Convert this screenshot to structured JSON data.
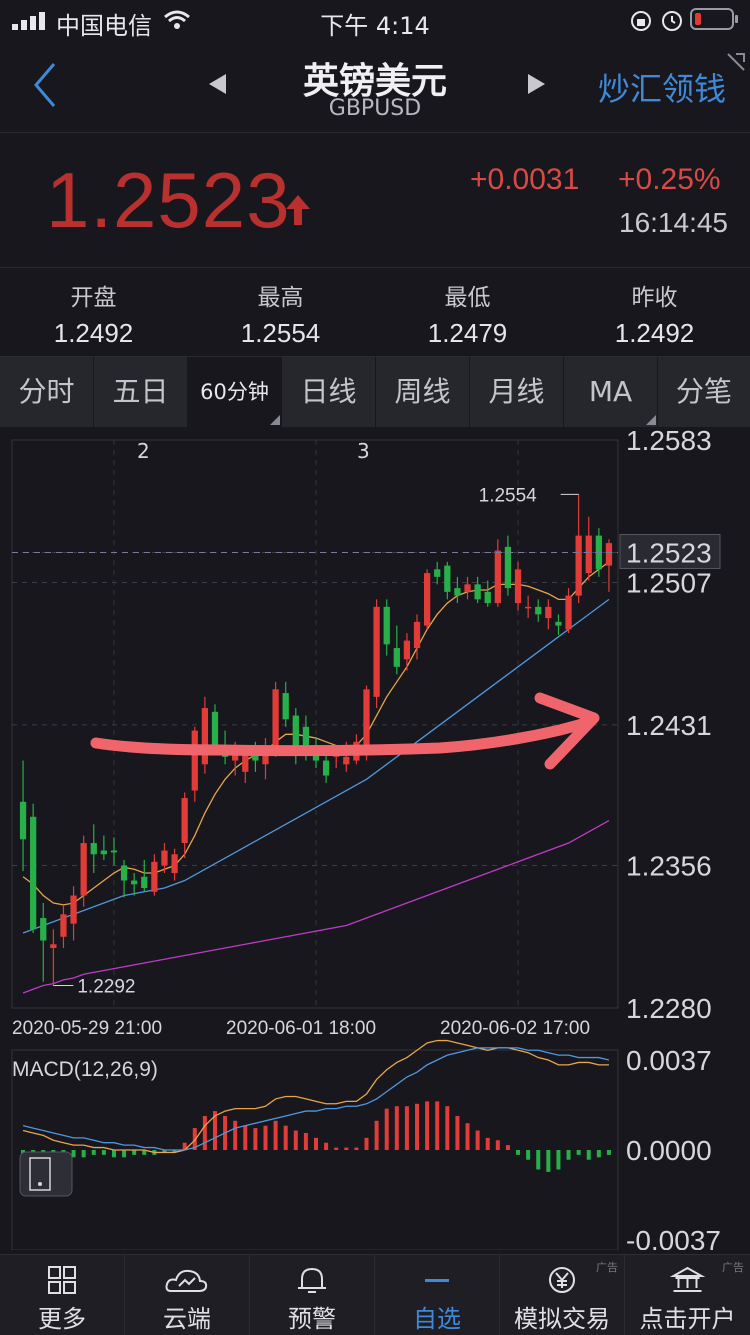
{
  "status": {
    "carrier": "中国电信",
    "time": "下午 4:14"
  },
  "nav": {
    "title": "英镑美元",
    "subtitle": "GBPUSD",
    "right_action": "炒汇领钱"
  },
  "quote": {
    "price": "1.2523",
    "change": "+0.0031",
    "change_pct": "+0.25%",
    "time": "16:14:45",
    "up_color": "#d94a45"
  },
  "stats": [
    {
      "label": "开盘",
      "value": "1.2492"
    },
    {
      "label": "最高",
      "value": "1.2554"
    },
    {
      "label": "最低",
      "value": "1.2479"
    },
    {
      "label": "昨收",
      "value": "1.2492"
    }
  ],
  "tabs": [
    "分时",
    "五日",
    "60分钟",
    "日线",
    "周线",
    "月线",
    "MA",
    "分笔"
  ],
  "active_tab": 2,
  "chart_data": [
    {
      "type": "candlestick",
      "y_ticks": [
        "1.2583",
        "1.2523",
        "1.2507",
        "1.2431",
        "1.2356",
        "1.2280"
      ],
      "ylim": [
        1.228,
        1.2583
      ],
      "x_ticks": [
        "2020-05-29 21:00",
        "2020-06-01 18:00",
        "2020-06-02 17:00"
      ],
      "annotations": {
        "high": "1.2554",
        "low": "1.2292"
      },
      "top_markers": [
        "2",
        "3"
      ],
      "current_price_label": "1.2523",
      "candles": [
        {
          "o": 1.239,
          "h": 1.2412,
          "l": 1.2353,
          "c": 1.237
        },
        {
          "o": 1.2382,
          "h": 1.2389,
          "l": 1.232,
          "c": 1.2322
        },
        {
          "o": 1.2328,
          "h": 1.2336,
          "l": 1.2294,
          "c": 1.2316
        },
        {
          "o": 1.2312,
          "h": 1.2322,
          "l": 1.2292,
          "c": 1.2314
        },
        {
          "o": 1.2318,
          "h": 1.2335,
          "l": 1.2312,
          "c": 1.233
        },
        {
          "o": 1.2325,
          "h": 1.2345,
          "l": 1.2316,
          "c": 1.234
        },
        {
          "o": 1.234,
          "h": 1.2372,
          "l": 1.2334,
          "c": 1.2368
        },
        {
          "o": 1.2368,
          "h": 1.2378,
          "l": 1.2352,
          "c": 1.2362
        },
        {
          "o": 1.2364,
          "h": 1.2372,
          "l": 1.2359,
          "c": 1.2362
        },
        {
          "o": 1.2364,
          "h": 1.2371,
          "l": 1.2356,
          "c": 1.2363
        },
        {
          "o": 1.2356,
          "h": 1.2359,
          "l": 1.2339,
          "c": 1.2348
        },
        {
          "o": 1.2348,
          "h": 1.2352,
          "l": 1.234,
          "c": 1.2346
        },
        {
          "o": 1.235,
          "h": 1.2359,
          "l": 1.2342,
          "c": 1.2344
        },
        {
          "o": 1.2342,
          "h": 1.2362,
          "l": 1.234,
          "c": 1.2358
        },
        {
          "o": 1.2356,
          "h": 1.2368,
          "l": 1.2352,
          "c": 1.2364
        },
        {
          "o": 1.2352,
          "h": 1.2365,
          "l": 1.2348,
          "c": 1.2362
        },
        {
          "o": 1.2368,
          "h": 1.2395,
          "l": 1.236,
          "c": 1.2392
        },
        {
          "o": 1.2396,
          "h": 1.243,
          "l": 1.239,
          "c": 1.2428
        },
        {
          "o": 1.241,
          "h": 1.2446,
          "l": 1.2405,
          "c": 1.244
        },
        {
          "o": 1.2438,
          "h": 1.2442,
          "l": 1.2416,
          "c": 1.242
        },
        {
          "o": 1.242,
          "h": 1.2428,
          "l": 1.241,
          "c": 1.2414
        },
        {
          "o": 1.2412,
          "h": 1.2422,
          "l": 1.2404,
          "c": 1.2418
        },
        {
          "o": 1.2406,
          "h": 1.242,
          "l": 1.24,
          "c": 1.2416
        },
        {
          "o": 1.2418,
          "h": 1.2422,
          "l": 1.2406,
          "c": 1.2412
        },
        {
          "o": 1.241,
          "h": 1.2424,
          "l": 1.2402,
          "c": 1.2416
        },
        {
          "o": 1.242,
          "h": 1.2454,
          "l": 1.2414,
          "c": 1.245
        },
        {
          "o": 1.2448,
          "h": 1.2454,
          "l": 1.243,
          "c": 1.2434
        },
        {
          "o": 1.2436,
          "h": 1.244,
          "l": 1.241,
          "c": 1.2418
        },
        {
          "o": 1.243,
          "h": 1.2436,
          "l": 1.2412,
          "c": 1.242
        },
        {
          "o": 1.2416,
          "h": 1.2424,
          "l": 1.2408,
          "c": 1.2412
        },
        {
          "o": 1.2412,
          "h": 1.2418,
          "l": 1.24,
          "c": 1.2404
        },
        {
          "o": 1.2414,
          "h": 1.242,
          "l": 1.2408,
          "c": 1.2416
        },
        {
          "o": 1.241,
          "h": 1.2422,
          "l": 1.2406,
          "c": 1.2414
        },
        {
          "o": 1.2412,
          "h": 1.2426,
          "l": 1.241,
          "c": 1.2422
        },
        {
          "o": 1.2416,
          "h": 1.2452,
          "l": 1.2412,
          "c": 1.245
        },
        {
          "o": 1.2446,
          "h": 1.2498,
          "l": 1.244,
          "c": 1.2494
        },
        {
          "o": 1.2494,
          "h": 1.2498,
          "l": 1.2468,
          "c": 1.2474
        },
        {
          "o": 1.2472,
          "h": 1.2484,
          "l": 1.2458,
          "c": 1.2462
        },
        {
          "o": 1.2466,
          "h": 1.248,
          "l": 1.246,
          "c": 1.2476
        },
        {
          "o": 1.2472,
          "h": 1.249,
          "l": 1.2466,
          "c": 1.2486
        },
        {
          "o": 1.2484,
          "h": 1.2514,
          "l": 1.2482,
          "c": 1.2512
        },
        {
          "o": 1.2514,
          "h": 1.2518,
          "l": 1.2506,
          "c": 1.251
        },
        {
          "o": 1.2516,
          "h": 1.2518,
          "l": 1.2498,
          "c": 1.2502
        },
        {
          "o": 1.2504,
          "h": 1.251,
          "l": 1.2496,
          "c": 1.25
        },
        {
          "o": 1.2502,
          "h": 1.251,
          "l": 1.2498,
          "c": 1.2506
        },
        {
          "o": 1.2506,
          "h": 1.251,
          "l": 1.2496,
          "c": 1.2498
        },
        {
          "o": 1.2502,
          "h": 1.2508,
          "l": 1.2494,
          "c": 1.2496
        },
        {
          "o": 1.2496,
          "h": 1.253,
          "l": 1.2494,
          "c": 1.2524
        },
        {
          "o": 1.2526,
          "h": 1.2532,
          "l": 1.25,
          "c": 1.2504
        },
        {
          "o": 1.2496,
          "h": 1.2518,
          "l": 1.2492,
          "c": 1.2514
        },
        {
          "o": 1.2494,
          "h": 1.25,
          "l": 1.2488,
          "c": 1.2494
        },
        {
          "o": 1.2494,
          "h": 1.2498,
          "l": 1.2486,
          "c": 1.249
        },
        {
          "o": 1.2488,
          "h": 1.2498,
          "l": 1.2482,
          "c": 1.2494
        },
        {
          "o": 1.2486,
          "h": 1.249,
          "l": 1.2479,
          "c": 1.2484
        },
        {
          "o": 1.2482,
          "h": 1.2504,
          "l": 1.248,
          "c": 1.25
        },
        {
          "o": 1.25,
          "h": 1.2554,
          "l": 1.2496,
          "c": 1.2532
        },
        {
          "o": 1.2512,
          "h": 1.2542,
          "l": 1.2508,
          "c": 1.2532
        },
        {
          "o": 1.2532,
          "h": 1.2536,
          "l": 1.251,
          "c": 1.2514
        },
        {
          "o": 1.2516,
          "h": 1.253,
          "l": 1.2502,
          "c": 1.2528
        }
      ],
      "ma_lines": [
        {
          "color": "#e8a54a",
          "values": [
            1.235,
            1.2346,
            1.234,
            1.2336,
            1.2335,
            1.2336,
            1.234,
            1.2344,
            1.2348,
            1.2352,
            1.2355,
            1.2354,
            1.2352,
            1.2352,
            1.2354,
            1.2356,
            1.2362,
            1.2372,
            1.2384,
            1.2394,
            1.2402,
            1.2408,
            1.2412,
            1.2415,
            1.2417,
            1.2422,
            1.2426,
            1.2426,
            1.2425,
            1.2424,
            1.2422,
            1.242,
            1.2419,
            1.242,
            1.2426,
            1.2436,
            1.2446,
            1.2454,
            1.2462,
            1.2472,
            1.2482,
            1.249,
            1.2496,
            1.25,
            1.2502,
            1.2503,
            1.2503,
            1.2506,
            1.2506,
            1.2506,
            1.2505,
            1.2503,
            1.2501,
            1.2498,
            1.2498,
            1.2504,
            1.251,
            1.2514,
            1.2518
          ]
        },
        {
          "color": "#4f98dd",
          "values": [
            1.232,
            1.2322,
            1.2324,
            1.2326,
            1.2328,
            1.233,
            1.2332,
            1.2334,
            1.2336,
            1.2338,
            1.234,
            1.2341,
            1.2342,
            1.2343,
            1.2344,
            1.2346,
            1.2348,
            1.2351,
            1.2354,
            1.2357,
            1.236,
            1.2363,
            1.2366,
            1.2369,
            1.2372,
            1.2375,
            1.2378,
            1.2381,
            1.2384,
            1.2387,
            1.239,
            1.2393,
            1.2396,
            1.2399,
            1.2402,
            1.2406,
            1.241,
            1.2414,
            1.2418,
            1.2422,
            1.2426,
            1.243,
            1.2434,
            1.2438,
            1.2442,
            1.2446,
            1.245,
            1.2454,
            1.2458,
            1.2462,
            1.2466,
            1.247,
            1.2474,
            1.2478,
            1.2482,
            1.2486,
            1.249,
            1.2494,
            1.2498
          ]
        },
        {
          "color": "#c03ac8",
          "values": [
            1.2288,
            1.229,
            1.2292,
            1.2293,
            1.2295,
            1.2296,
            1.2298,
            1.2299,
            1.23,
            1.2301,
            1.2302,
            1.2303,
            1.2304,
            1.2305,
            1.2306,
            1.2307,
            1.2308,
            1.2309,
            1.231,
            1.2311,
            1.2312,
            1.2313,
            1.2314,
            1.2315,
            1.2316,
            1.2317,
            1.2318,
            1.2319,
            1.232,
            1.2321,
            1.2322,
            1.2323,
            1.2324,
            1.2326,
            1.2328,
            1.233,
            1.2332,
            1.2334,
            1.2336,
            1.2338,
            1.234,
            1.2342,
            1.2344,
            1.2346,
            1.2348,
            1.235,
            1.2352,
            1.2354,
            1.2356,
            1.2358,
            1.236,
            1.2362,
            1.2364,
            1.2366,
            1.2368,
            1.2371,
            1.2374,
            1.2377,
            1.238
          ]
        }
      ]
    },
    {
      "type": "bar",
      "title": "MACD(12,26,9)",
      "y_ticks": [
        "0.0037",
        "0.0000",
        "-0.0037"
      ],
      "ylim": [
        -0.0037,
        0.0037
      ],
      "values": [
        -0.0002,
        -0.0002,
        -0.0002,
        -0.0003,
        -0.0004,
        -0.0003,
        -0.0003,
        -0.0002,
        -0.0002,
        -0.0003,
        -0.0003,
        -0.0002,
        -0.0002,
        -0.0002,
        -0.0001,
        -0.0001,
        0.0003,
        0.0009,
        0.0014,
        0.0016,
        0.0014,
        0.0012,
        0.001,
        0.0009,
        0.001,
        0.0012,
        0.001,
        0.0008,
        0.0007,
        0.0005,
        0.0003,
        0.0001,
        0.0001,
        0.0001,
        0.0005,
        0.0012,
        0.0017,
        0.0018,
        0.0018,
        0.0019,
        0.002,
        0.002,
        0.0018,
        0.0014,
        0.0011,
        0.0008,
        0.0005,
        0.0004,
        0.0002,
        -0.0002,
        -0.0004,
        -0.0008,
        -0.0009,
        -0.0008,
        -0.0004,
        -0.0002,
        -0.0004,
        -0.0003,
        -0.0002
      ],
      "dif": [
        0.0008,
        0.0007,
        0.0006,
        0.0004,
        0.0003,
        0.0002,
        0.0002,
        0.0001,
        0.0001,
        0.0,
        0.0,
        0.0,
        0.0,
        -0.0001,
        -0.0001,
        -0.0001,
        0.0,
        0.0004,
        0.001,
        0.0014,
        0.0016,
        0.0017,
        0.0017,
        0.0017,
        0.0018,
        0.0021,
        0.0022,
        0.0022,
        0.0021,
        0.002,
        0.0019,
        0.0019,
        0.002,
        0.002,
        0.0023,
        0.0029,
        0.0033,
        0.0036,
        0.0038,
        0.0041,
        0.0044,
        0.0045,
        0.0045,
        0.0044,
        0.0043,
        0.0042,
        0.0041,
        0.0042,
        0.0042,
        0.0041,
        0.004,
        0.0038,
        0.0037,
        0.0035,
        0.0035,
        0.0036,
        0.0036,
        0.0035,
        0.0035
      ],
      "dea": [
        0.001,
        0.0009,
        0.0008,
        0.0007,
        0.0006,
        0.0005,
        0.0005,
        0.0004,
        0.0003,
        0.0003,
        0.0002,
        0.0002,
        0.0001,
        0.0001,
        0.0,
        0.0,
        0.0,
        0.0001,
        0.0003,
        0.0005,
        0.0007,
        0.0009,
        0.001,
        0.0011,
        0.0012,
        0.0013,
        0.0014,
        0.0015,
        0.0016,
        0.0016,
        0.0017,
        0.0017,
        0.0018,
        0.0018,
        0.0019,
        0.0021,
        0.0024,
        0.0027,
        0.003,
        0.0032,
        0.0035,
        0.0037,
        0.0039,
        0.004,
        0.0041,
        0.0042,
        0.0042,
        0.0042,
        0.0042,
        0.0042,
        0.0041,
        0.0041,
        0.004,
        0.0039,
        0.0039,
        0.0038,
        0.0038,
        0.0038,
        0.0037
      ]
    }
  ],
  "bottom_bar": [
    {
      "label": "更多",
      "icon": "grid-icon"
    },
    {
      "label": "云端",
      "icon": "cloud-icon"
    },
    {
      "label": "预警",
      "icon": "bell-icon"
    },
    {
      "label": "自选",
      "icon": "dash-icon"
    },
    {
      "label": "模拟交易",
      "icon": "yen-icon"
    },
    {
      "label": "点击开户",
      "icon": "bank-icon"
    }
  ],
  "active_bottom": 3,
  "ad_label": "广告"
}
